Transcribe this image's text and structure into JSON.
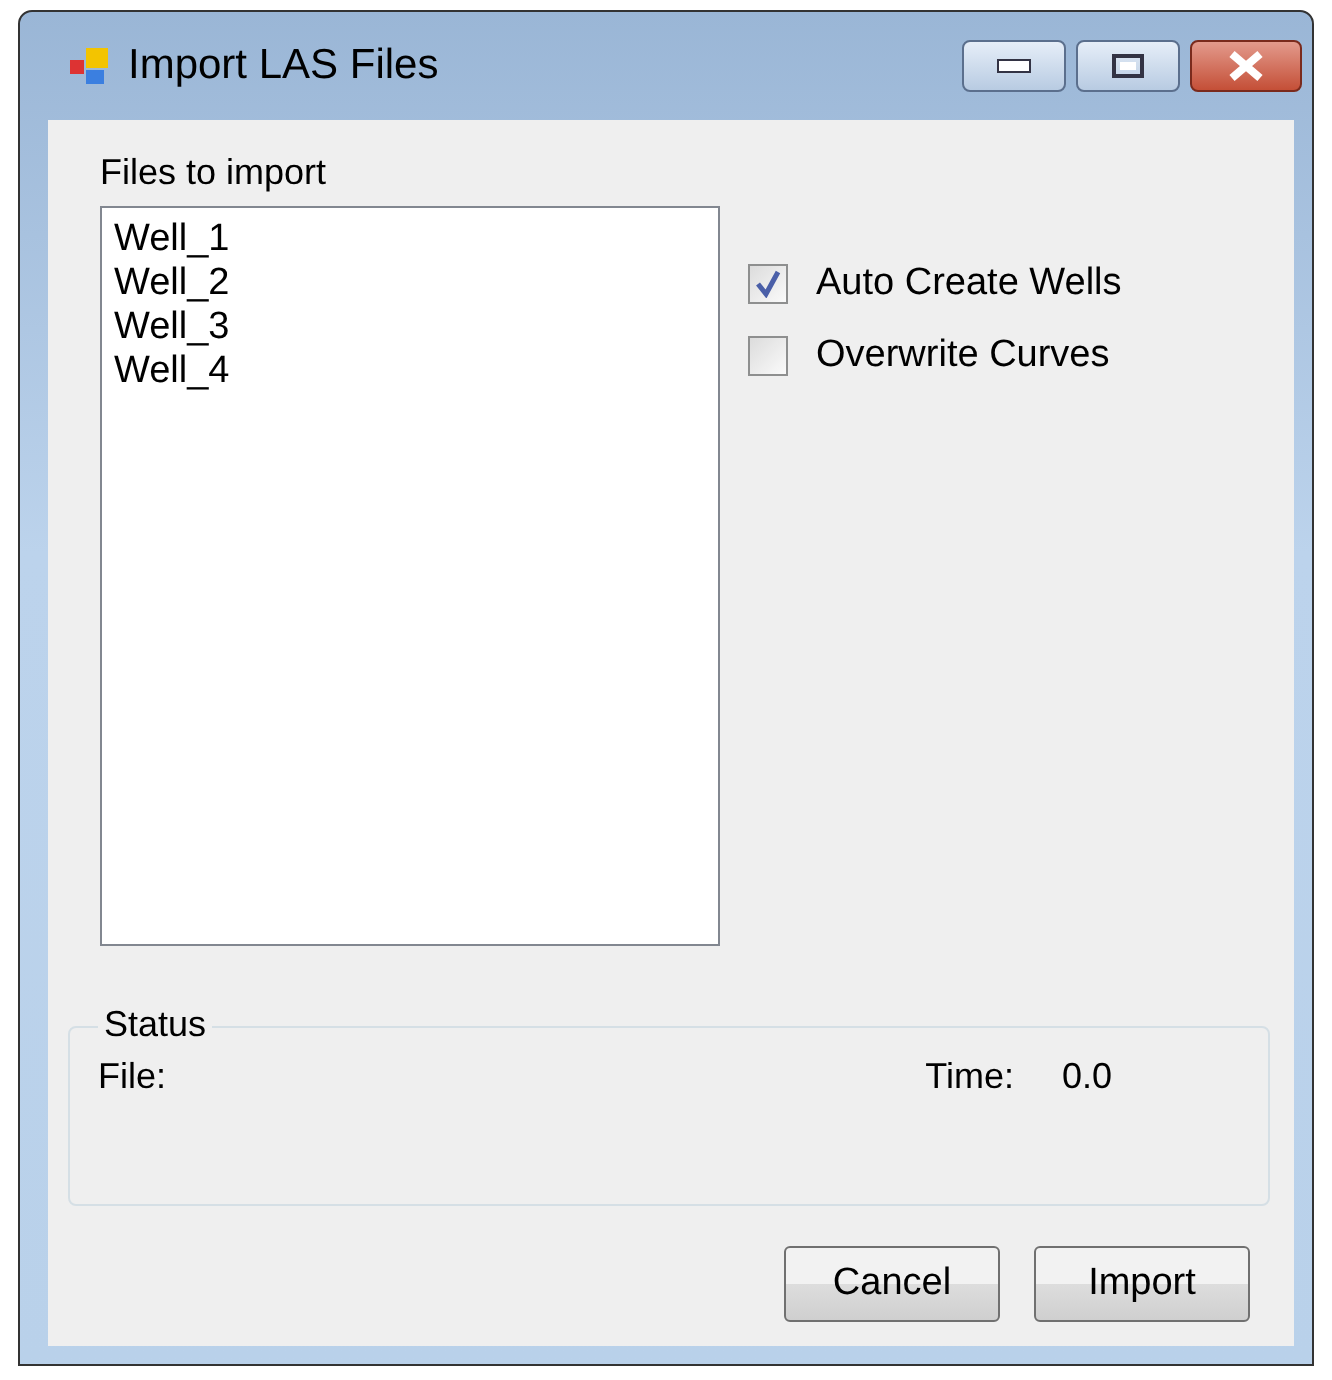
{
  "window": {
    "title": "Import LAS Files"
  },
  "files_label": "Files to import",
  "files": [
    {
      "name": "Well_1"
    },
    {
      "name": "Well_2"
    },
    {
      "name": "Well_3"
    },
    {
      "name": "Well_4"
    }
  ],
  "options": [
    {
      "label": "Auto Create Wells",
      "checked": true
    },
    {
      "label": "Overwrite Curves",
      "checked": false
    }
  ],
  "status": {
    "title": "Status",
    "file_label": "File:",
    "time_label": "Time:",
    "time_value": "0.0"
  },
  "buttons": [
    "Cancel",
    "Import"
  ]
}
